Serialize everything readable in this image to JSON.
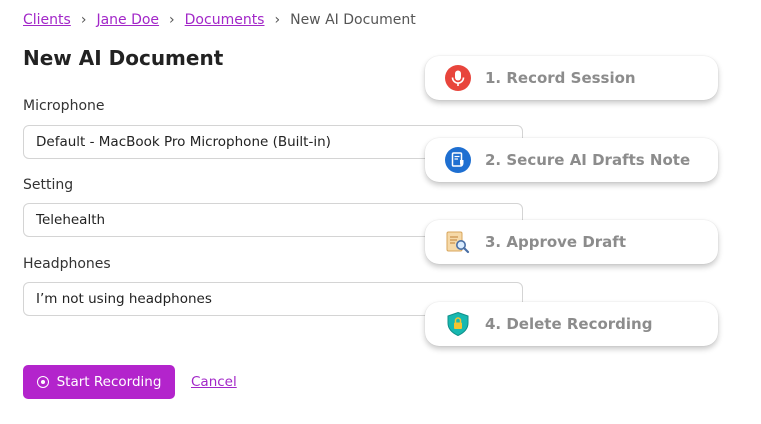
{
  "breadcrumb": {
    "items": [
      "Clients",
      "Jane Doe",
      "Documents"
    ],
    "current": "New AI Document",
    "separator": "›"
  },
  "page": {
    "title": "New AI Document"
  },
  "form": {
    "microphone": {
      "label": "Microphone",
      "value": "Default - MacBook Pro Microphone (Built-in)"
    },
    "setting": {
      "label": "Setting",
      "value": "Telehealth"
    },
    "headphones": {
      "label": "Headphones",
      "value": "I’m not using headphones"
    }
  },
  "actions": {
    "start_label": "Start Recording",
    "cancel_label": "Cancel"
  },
  "steps": [
    {
      "label": "1. Record Session",
      "icon": "microphone-icon"
    },
    {
      "label": "2. Secure AI Drafts Note",
      "icon": "secure-document-icon"
    },
    {
      "label": "3. Approve Draft",
      "icon": "document-search-icon"
    },
    {
      "label": "4. Delete Recording",
      "icon": "shield-lock-icon"
    }
  ],
  "colors": {
    "accent": "#b324cc",
    "link": "#a227c8",
    "step_text": "#8c8c8c"
  }
}
